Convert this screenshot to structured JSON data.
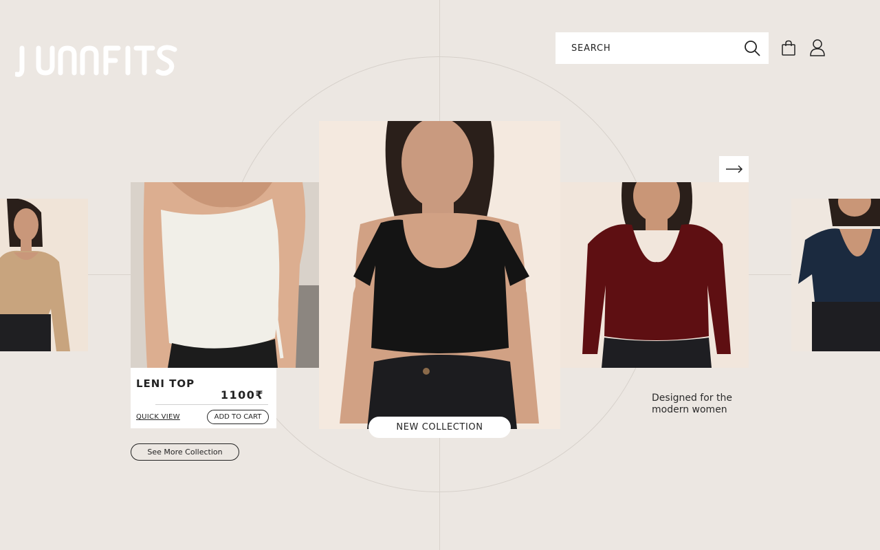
{
  "brand": {
    "logo_text": "JUNNFITS"
  },
  "header": {
    "search": {
      "placeholder": "SEARCH",
      "icon": "search-icon"
    },
    "cart_icon": "shopping-bag-icon",
    "user_icon": "user-icon"
  },
  "carousel": {
    "next_icon": "arrow-right-icon",
    "items": [
      {
        "garment": "beige long-sleeve crop top",
        "color": "#c8a47e"
      },
      {
        "garment": "white strapless ruched top",
        "color": "#f1efe8"
      },
      {
        "garment": "black short-sleeve crop top",
        "color": "#141414"
      },
      {
        "garment": "maroon long-sleeve crop top",
        "color": "#5e0f12"
      },
      {
        "garment": "navy short-sleeve crop top",
        "color": "#1b2a3f"
      }
    ]
  },
  "product_card": {
    "name": "LENI TOP",
    "price": "1100₹",
    "quick_view_label": "QUICK VIEW",
    "add_to_cart_label": "ADD TO CART"
  },
  "see_more_label": "See More Collection",
  "new_collection_label": "NEW COLLECTION",
  "tagline": "Designed for the modern women",
  "colors": {
    "background": "#ece7e2",
    "text": "#222222",
    "surface": "#ffffff"
  }
}
